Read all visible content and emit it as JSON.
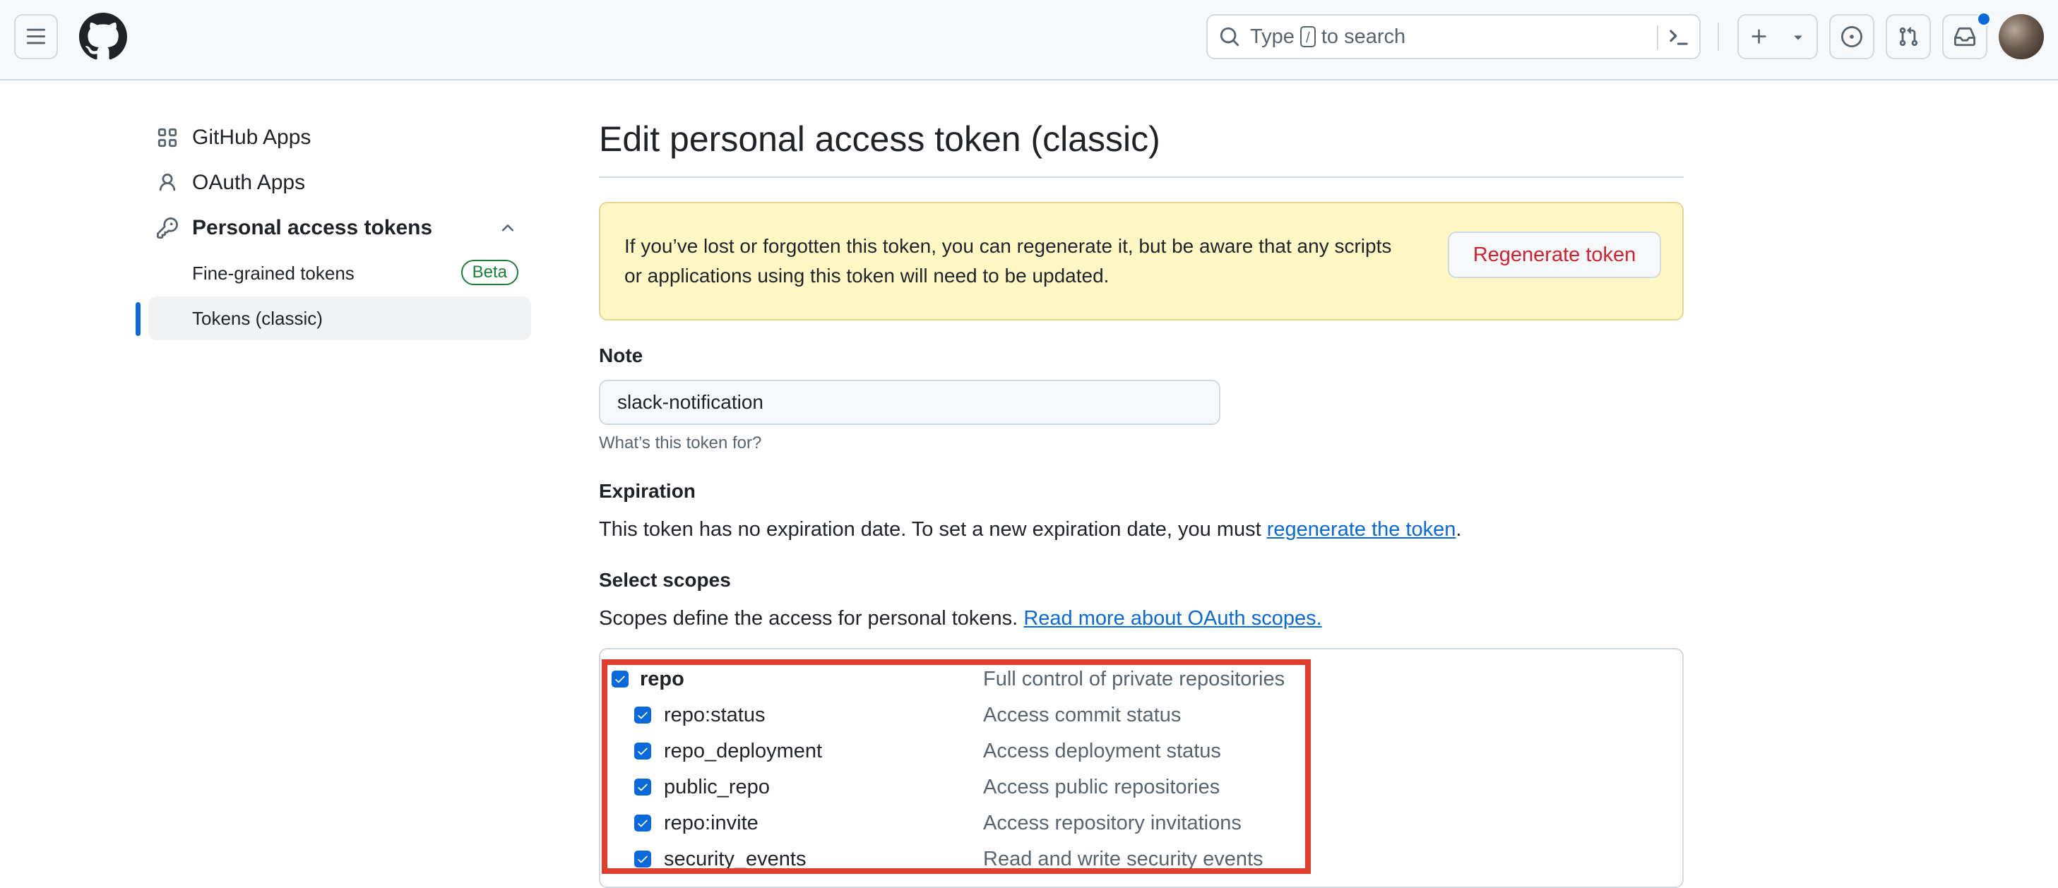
{
  "header": {
    "search": {
      "prefix": "Type",
      "key": "/",
      "suffix": "to search"
    },
    "notification_dot_color": "#0969da"
  },
  "sidebar": {
    "items": [
      {
        "label": "GitHub Apps",
        "icon": "apps-grid-icon"
      },
      {
        "label": "OAuth Apps",
        "icon": "person-icon"
      },
      {
        "label": "Personal access tokens",
        "icon": "key-icon",
        "expanded": true
      }
    ],
    "subitems": [
      {
        "label": "Fine-grained tokens",
        "badge": "Beta"
      },
      {
        "label": "Tokens (classic)",
        "active": true
      }
    ]
  },
  "main": {
    "title": "Edit personal access token (classic)",
    "flash": {
      "message": "If you’ve lost or forgotten this token, you can regenerate it, but be aware that any scripts or applications using this token will need to be updated.",
      "button": "Regenerate token"
    },
    "note": {
      "label": "Note",
      "value": "slack-notification",
      "hint": "What’s this token for?"
    },
    "expiration": {
      "label": "Expiration",
      "text": "This token has no expiration date. To set a new expiration date, you must",
      "link": "regenerate the token",
      "end": "."
    },
    "scopes": {
      "label": "Select scopes",
      "text": "Scopes define the access for personal tokens.",
      "link": "Read more about OAuth scopes.",
      "items": [
        {
          "name": "repo",
          "desc": "Full control of private repositories",
          "checked": true
        },
        {
          "name": "repo:status",
          "desc": "Access commit status",
          "checked": true
        },
        {
          "name": "repo_deployment",
          "desc": "Access deployment status",
          "checked": true
        },
        {
          "name": "public_repo",
          "desc": "Access public repositories",
          "checked": true
        },
        {
          "name": "repo:invite",
          "desc": "Access repository invitations",
          "checked": true
        },
        {
          "name": "security_events",
          "desc": "Read and write security events",
          "checked": true
        }
      ]
    }
  },
  "colors": {
    "accent": "#0969da",
    "danger": "#cf222e",
    "highlight": "#e03e2d",
    "flash_bg": "#fff8c5"
  }
}
